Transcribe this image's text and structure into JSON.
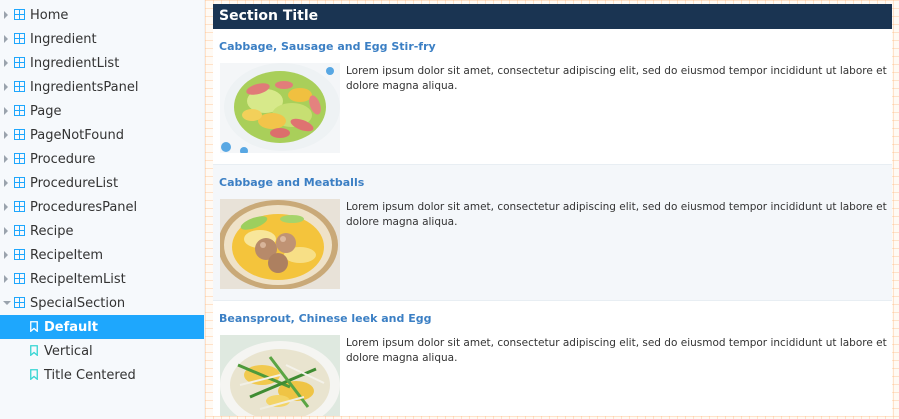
{
  "sidebar": {
    "items": [
      {
        "label": "Home"
      },
      {
        "label": "Ingredient"
      },
      {
        "label": "IngredientList"
      },
      {
        "label": "IngredientsPanel"
      },
      {
        "label": "Page"
      },
      {
        "label": "PageNotFound"
      },
      {
        "label": "Procedure"
      },
      {
        "label": "ProcedureList"
      },
      {
        "label": "ProceduresPanel"
      },
      {
        "label": "Recipe"
      },
      {
        "label": "RecipeItem"
      },
      {
        "label": "RecipeItemList"
      },
      {
        "label": "SpecialSection"
      }
    ],
    "stories": [
      {
        "label": "Default"
      },
      {
        "label": "Vertical"
      },
      {
        "label": "Title Centered"
      }
    ]
  },
  "section": {
    "title": "Section Title",
    "recipes": [
      {
        "title": "Cabbage, Sausage and Egg Stir-fry",
        "description": "Lorem ipsum dolor sit amet, consectetur adipiscing elit, sed do eiusmod tempor incididunt ut labore et dolore magna aliqua."
      },
      {
        "title": "Cabbage and Meatballs",
        "description": "Lorem ipsum dolor sit amet, consectetur adipiscing elit, sed do eiusmod tempor incididunt ut labore et dolore magna aliqua."
      },
      {
        "title": "Beansprout, Chinese leek and Egg",
        "description": "Lorem ipsum dolor sit amet, consectetur adipiscing elit, sed do eiusmod tempor incididunt ut labore et dolore magna aliqua."
      }
    ]
  },
  "colors": {
    "selected": "#1ea7fd",
    "header": "#1a3452",
    "link": "#3b7fc4"
  }
}
